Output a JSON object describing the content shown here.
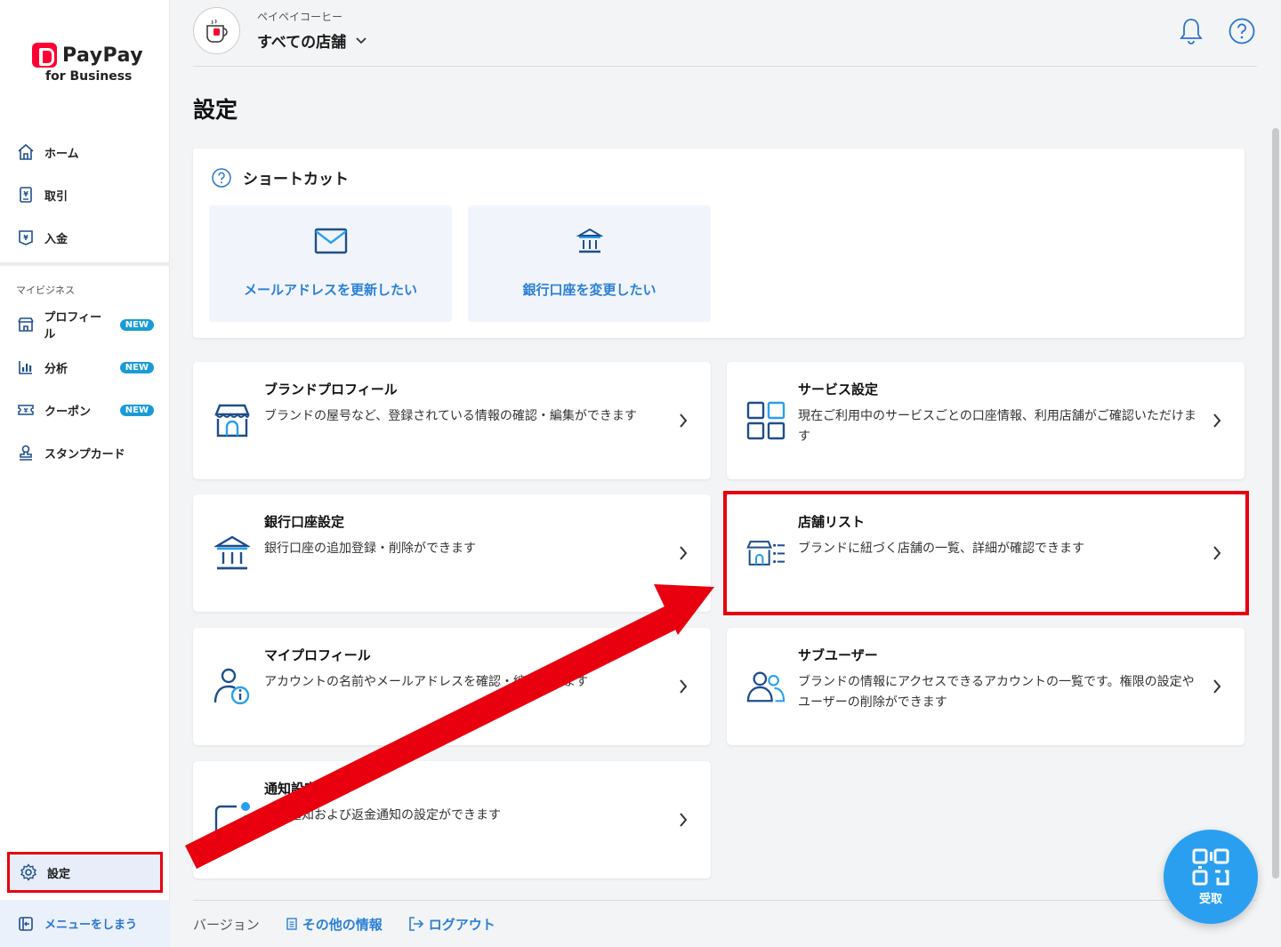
{
  "brand": {
    "name": "PayPay",
    "sub": "for Business"
  },
  "sidebar": {
    "items": [
      {
        "label": "ホーム",
        "icon": "home-icon"
      },
      {
        "label": "取引",
        "icon": "receipt-icon"
      },
      {
        "label": "入金",
        "icon": "deposit-icon"
      }
    ],
    "section_label": "マイビジネス",
    "business_items": [
      {
        "label": "プロフィール",
        "icon": "store-icon",
        "badge": "NEW"
      },
      {
        "label": "分析",
        "icon": "chart-icon",
        "badge": "NEW"
      },
      {
        "label": "クーポン",
        "icon": "coupon-icon",
        "badge": "NEW"
      },
      {
        "label": "スタンプカード",
        "icon": "stamp-icon"
      }
    ],
    "settings_label": "設定",
    "collapse_label": "メニューをしまう"
  },
  "header": {
    "company": "ペイペイコーヒー",
    "store_selector": "すべての店舗"
  },
  "page_title": "設定",
  "shortcut": {
    "title": "ショートカット",
    "tiles": [
      {
        "label": "メールアドレスを更新したい",
        "icon": "mail-icon"
      },
      {
        "label": "銀行口座を変更したい",
        "icon": "bank-icon"
      }
    ]
  },
  "cards": [
    {
      "title": "ブランドプロフィール",
      "desc": "ブランドの屋号など、登録されている情報の確認・編集ができます",
      "icon": "store-icon"
    },
    {
      "title": "サービス設定",
      "desc": "現在ご利用中のサービスごとの口座情報、利用店舗がご確認いただけます",
      "icon": "grid-icon"
    },
    {
      "title": "銀行口座設定",
      "desc": "銀行口座の追加登録・削除ができます",
      "icon": "bank-icon"
    },
    {
      "title": "店舗リスト",
      "desc": "ブランドに紐づく店舗の一覧、詳細が確認できます",
      "icon": "store-list-icon"
    },
    {
      "title": "マイプロフィール",
      "desc": "アカウントの名前やメールアドレスを確認・編集できます",
      "icon": "user-info-icon"
    },
    {
      "title": "サブユーザー",
      "desc": "ブランドの情報にアクセスできるアカウントの一覧です。権限の設定やユーザーの削除ができます",
      "icon": "users-icon"
    },
    {
      "title": "通知設定",
      "desc": "取引通知および返金通知の設定ができます",
      "icon": "notification-icon"
    }
  ],
  "footer": {
    "version": "バージョン",
    "other_info": "その他の情報",
    "logout": "ログアウト"
  },
  "fab": {
    "label": "受取",
    "icon": "qr-code-icon"
  },
  "colors": {
    "accent": "#2b7fd4",
    "highlight": "#e8000f",
    "brand": "#ff0033"
  }
}
